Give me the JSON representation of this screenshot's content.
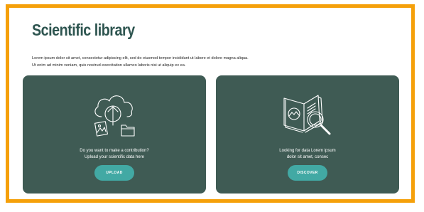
{
  "page": {
    "title": "Scientific library",
    "intro_line1": "Lorem ipsum dolor sit amet, consectetur adipiscing elit, sed do eiusmod tempor incididunt ut labore et dolore magna aliqua.",
    "intro_line2": "Ut enim ad minim veniam, quis nostrud exercitation ullamco laboris nisi ut aliquip ex ea."
  },
  "cards": {
    "upload": {
      "icon": "cloud-upload-icon",
      "text_line1": "Do you want to make a contribution?",
      "text_line2": "Upload your scientific data here",
      "button_label": "UPLOAD"
    },
    "discover": {
      "icon": "book-magnifier-icon",
      "text_line1": "Looking for data Lorem ipsum",
      "text_line2": "dolor sit amet, consec",
      "button_label": "DISCOVER"
    }
  },
  "colors": {
    "frame_border": "#f5a00a",
    "title": "#2e5550",
    "card_background": "#3f5b54",
    "button_background": "#42a9a4"
  }
}
